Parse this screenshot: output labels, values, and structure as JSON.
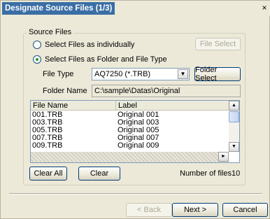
{
  "window": {
    "title": "Designate Source Files (1/3)",
    "close_glyph": "×"
  },
  "source_files": {
    "group_label": "Source Files",
    "option_individually": "Select Files as individually",
    "option_folder": "Select Files as Folder and File Type",
    "selected_option": "folder",
    "file_select_label": "File Select",
    "file_type_label": "File Type",
    "file_type_value": "AQ7250 (*.TRB)",
    "folder_select_label": "Folder Select",
    "folder_name_label": "Folder Name",
    "folder_name_value": "C:\\sample\\Datas\\Original"
  },
  "file_list": {
    "columns": [
      "File Name",
      "Label"
    ],
    "rows": [
      {
        "name": "001.TRB",
        "label": "Original 001"
      },
      {
        "name": "003.TRB",
        "label": "Original 003"
      },
      {
        "name": "005.TRB",
        "label": "Original 005"
      },
      {
        "name": "007.TRB",
        "label": "Original 007"
      },
      {
        "name": "009.TRB",
        "label": "Original 009"
      }
    ]
  },
  "list_actions": {
    "clear_all_label": "Clear All",
    "clear_label": "Clear",
    "count_text": "Number of files10"
  },
  "footer": {
    "back_label": "< Back",
    "next_label": "Next >",
    "cancel_label": "Cancel"
  },
  "icons": {
    "dropdown": "chevron-down-icon",
    "scroll_up": "arrow-up-icon",
    "scroll_down": "arrow-down-icon",
    "scroll_right": "arrow-right-icon"
  }
}
